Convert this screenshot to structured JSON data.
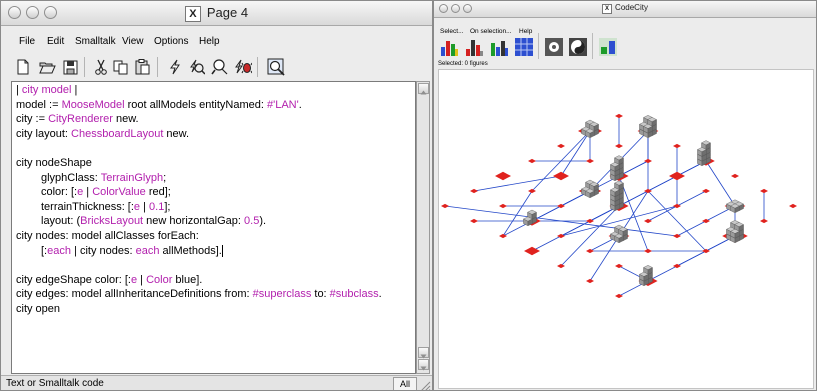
{
  "editor_window": {
    "title": "Page 4",
    "menu": [
      "File",
      "Edit",
      "Smalltalk",
      "View",
      "Options",
      "Help"
    ],
    "toolbar_icons": [
      "new-page-icon",
      "open-folder-icon",
      "save-disk-icon",
      "cut-scissors-icon",
      "copy-icon",
      "paste-icon",
      "do-it-bolt-icon",
      "print-it-icon",
      "inspect-magnifier-icon",
      "debug-bug-icon",
      "find-magnifier-icon"
    ],
    "code_lines": [
      [
        {
          "t": "| "
        },
        {
          "t": "city model",
          "c": "pink"
        },
        {
          "t": " |"
        }
      ],
      [
        {
          "t": "model := "
        },
        {
          "t": "MooseModel",
          "c": "pink"
        },
        {
          "t": " root allModels entityNamed: "
        },
        {
          "t": "#'LAN'",
          "c": "pink"
        },
        {
          "t": "."
        }
      ],
      [
        {
          "t": "city := "
        },
        {
          "t": "CityRenderer",
          "c": "pink"
        },
        {
          "t": " new."
        }
      ],
      [
        {
          "t": "city layout: "
        },
        {
          "t": "ChessboardLayout",
          "c": "pink"
        },
        {
          "t": " new."
        }
      ],
      [],
      [
        {
          "t": "city nodeShape"
        }
      ],
      [
        {
          "t": "glyphClass: "
        },
        {
          "t": "TerrainGlyph",
          "c": "pink"
        },
        {
          "t": ";"
        }
      ],
      [
        {
          "t": "color: [:"
        },
        {
          "t": "e",
          "c": "pink"
        },
        {
          "t": " | "
        },
        {
          "t": "ColorValue",
          "c": "pink"
        },
        {
          "t": " red];"
        }
      ],
      [
        {
          "t": "terrainThickness: [:"
        },
        {
          "t": "e",
          "c": "pink"
        },
        {
          "t": " | "
        },
        {
          "t": "0.1",
          "c": "pink"
        },
        {
          "t": "];"
        }
      ],
      [
        {
          "t": "layout: ("
        },
        {
          "t": "BricksLayout",
          "c": "pink"
        },
        {
          "t": " new horizontalGap: "
        },
        {
          "t": "0.5",
          "c": "pink"
        },
        {
          "t": ")."
        }
      ],
      [
        {
          "t": "city nodes: model allClasses forEach:"
        }
      ],
      [
        {
          "t": "[:"
        },
        {
          "t": "each",
          "c": "pink"
        },
        {
          "t": " | city nodes: "
        },
        {
          "t": "each",
          "c": "pink"
        },
        {
          "t": " allMethods]."
        }
      ],
      [],
      [
        {
          "t": "city edgeShape color: [:"
        },
        {
          "t": "e",
          "c": "pink"
        },
        {
          "t": " | "
        },
        {
          "t": "Color",
          "c": "pink"
        },
        {
          "t": " blue]."
        }
      ],
      [
        {
          "t": "city edges: model allInheritanceDefinitions from: "
        },
        {
          "t": "#superclass",
          "c": "pink"
        },
        {
          "t": " to: "
        },
        {
          "t": "#subclass",
          "c": "pink"
        },
        {
          "t": "."
        }
      ],
      [
        {
          "t": "city open"
        }
      ]
    ],
    "indented_lines": [
      6,
      7,
      8,
      9,
      11
    ],
    "status_text": "Text or Smalltalk code",
    "mode_button": "All"
  },
  "codecity_window": {
    "title": "CodeCity",
    "menu": [
      "Select...",
      "On selection...",
      "Help"
    ],
    "toolbar_icons": [
      "bar-chart-icon",
      "bar-chart-icon",
      "bar-chart-icon",
      "grid-icon",
      "settings-icon",
      "yin-yang-icon",
      "layout-icon"
    ],
    "selected_label": "Selected: 0 figures"
  },
  "colors": {
    "keyword_pink": "#b21fad",
    "edge_blue": "#2246c8",
    "terrain_red": "#e0221e",
    "building_gray": "#9a9a9a"
  }
}
